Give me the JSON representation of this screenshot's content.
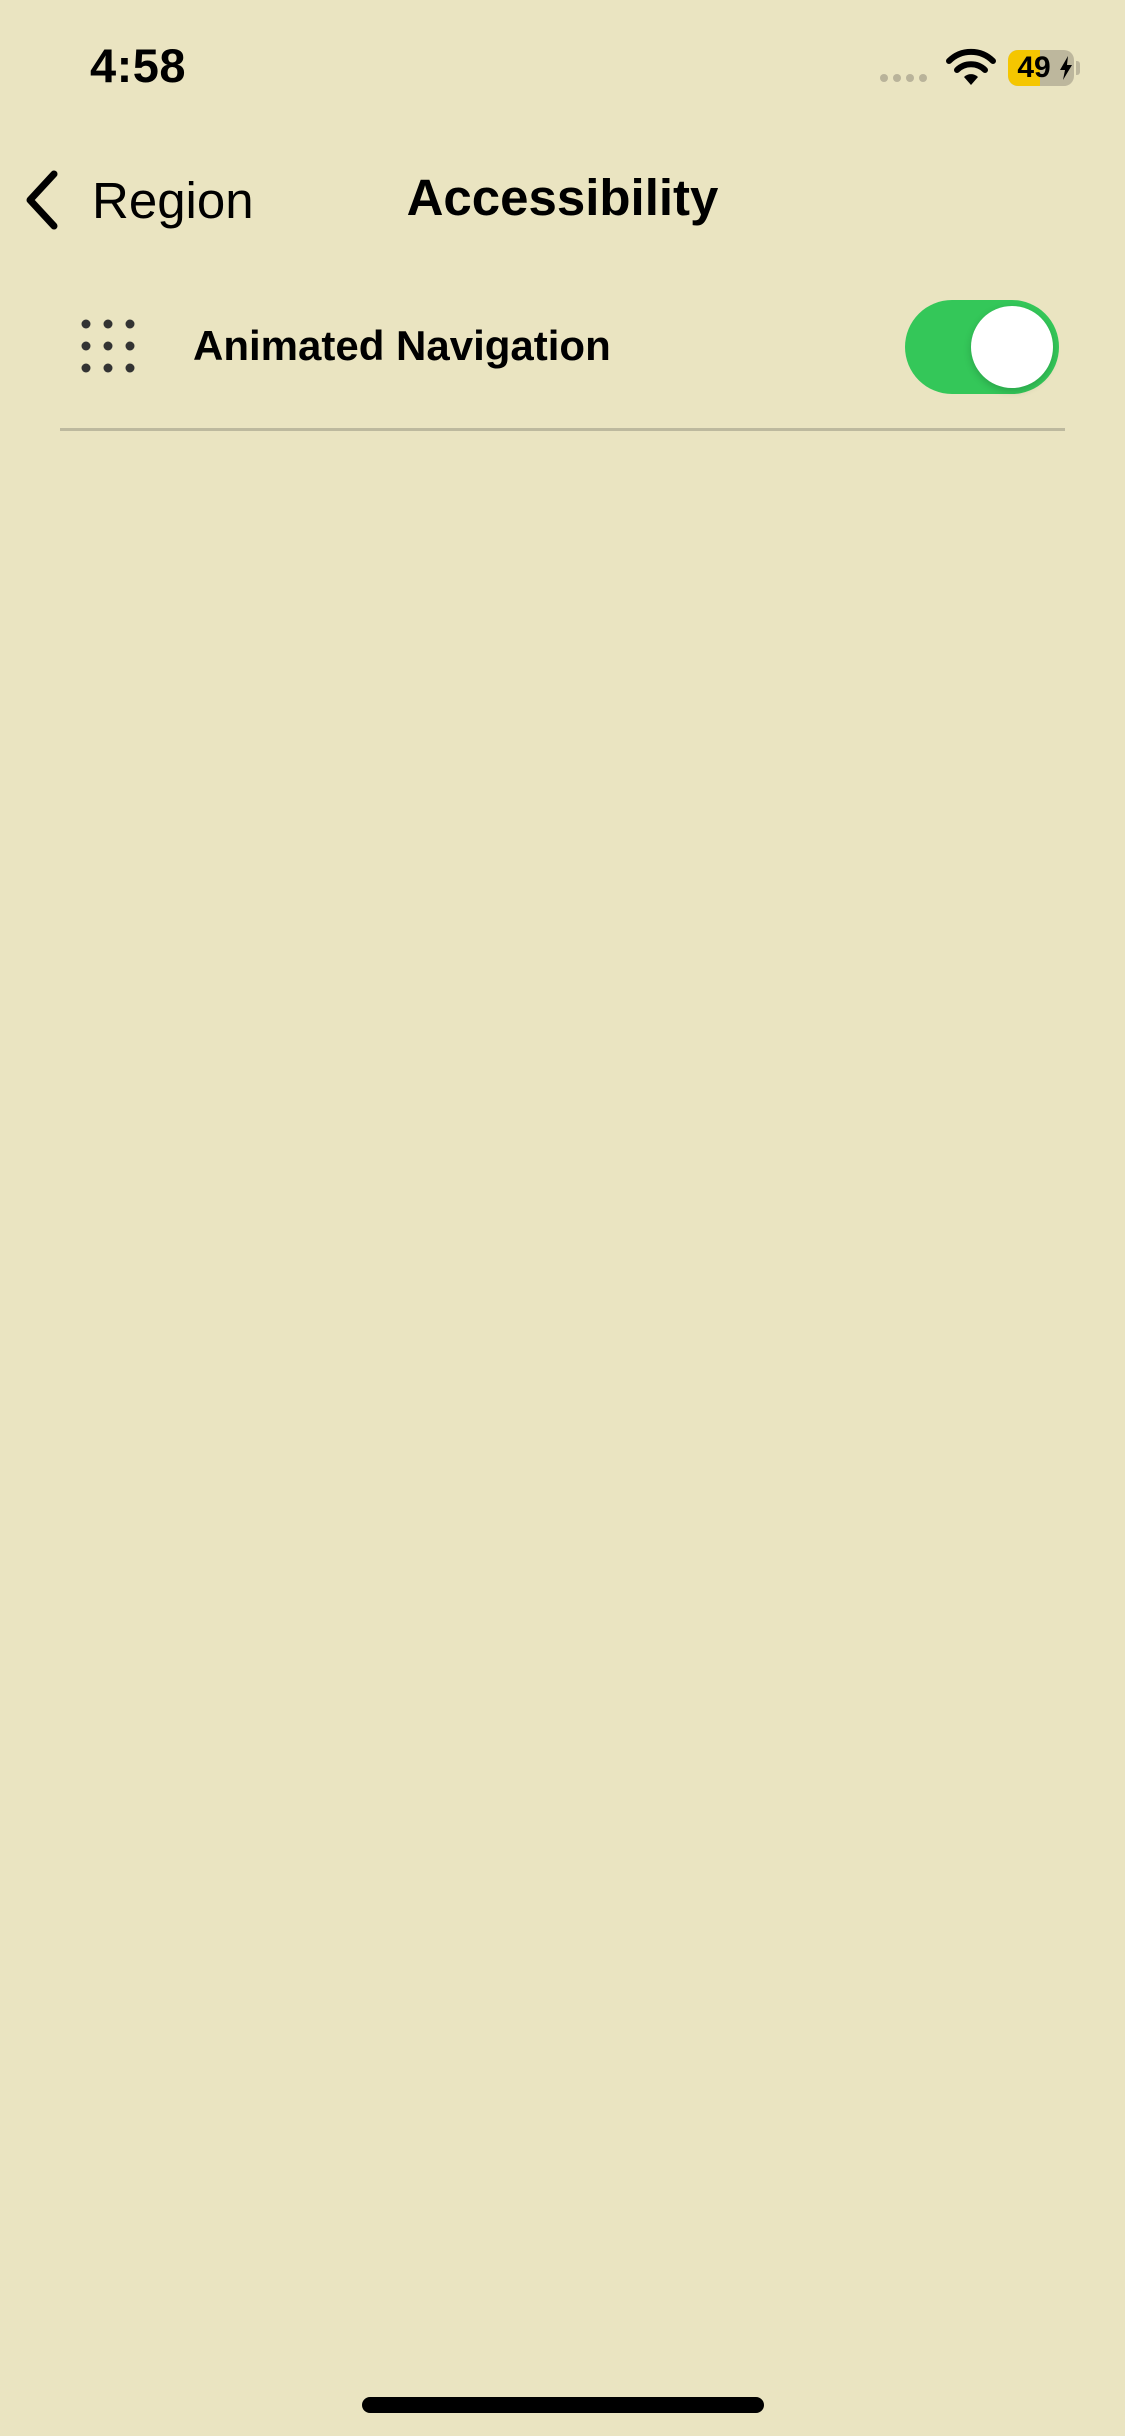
{
  "status_bar": {
    "time": "4:58",
    "battery_percent": "49",
    "battery_level": 0.49,
    "charging": true
  },
  "nav": {
    "back_label": "Region",
    "title": "Accessibility"
  },
  "settings": [
    {
      "label": "Animated Navigation",
      "icon": "dots-grid-icon",
      "enabled": true
    }
  ],
  "colors": {
    "background": "#EAE4C1",
    "toggle_on": "#34C759",
    "battery_fill": "#F5C600",
    "divider": "#BDB99E"
  }
}
